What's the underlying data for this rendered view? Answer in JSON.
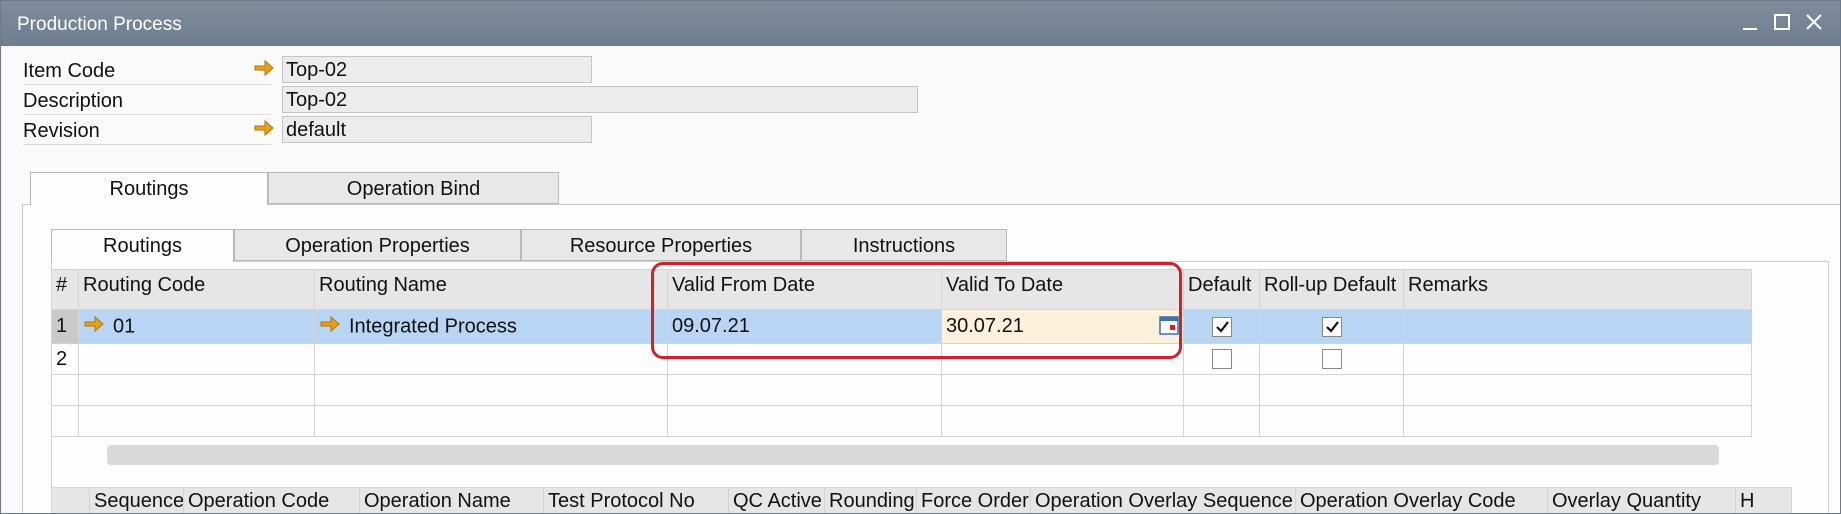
{
  "window": {
    "title": "Production Process"
  },
  "header_fields": {
    "item_code": {
      "label": "Item Code",
      "value": "Top-02"
    },
    "description": {
      "label": "Description",
      "value": "Top-02"
    },
    "revision": {
      "label": "Revision",
      "value": "default"
    }
  },
  "outer_tabs": [
    "Routings",
    "Operation Bind"
  ],
  "inner_tabs": [
    "Routings",
    "Operation Properties",
    "Resource Properties",
    "Instructions"
  ],
  "routing_grid": {
    "columns": [
      "#",
      "Routing Code",
      "Routing Name",
      "Valid From Date",
      "Valid To Date",
      "Default",
      "Roll-up Default",
      "Remarks"
    ],
    "rows": [
      {
        "num": "1",
        "code": "01",
        "name": "Integrated Process",
        "valid_from": "09.07.21",
        "valid_to": "30.07.21",
        "default": true,
        "rollup_default": true,
        "remarks": ""
      },
      {
        "num": "2",
        "code": "",
        "name": "",
        "valid_from": "",
        "valid_to": "",
        "default": false,
        "rollup_default": false,
        "remarks": ""
      }
    ]
  },
  "operation_grid": {
    "columns": [
      "Sequence",
      "Operation Code",
      "Operation Name",
      "Test Protocol No",
      "QC Active",
      "Rounding",
      "Force Order",
      "Operation Overlay Sequence",
      "Operation Overlay Code",
      "Overlay Quantity",
      "H"
    ]
  },
  "colors": {
    "titlebar": "#76859a",
    "highlight": "#d0202a",
    "selected_row": "#b8d5f3",
    "link_arrow": "#e8a11a"
  }
}
